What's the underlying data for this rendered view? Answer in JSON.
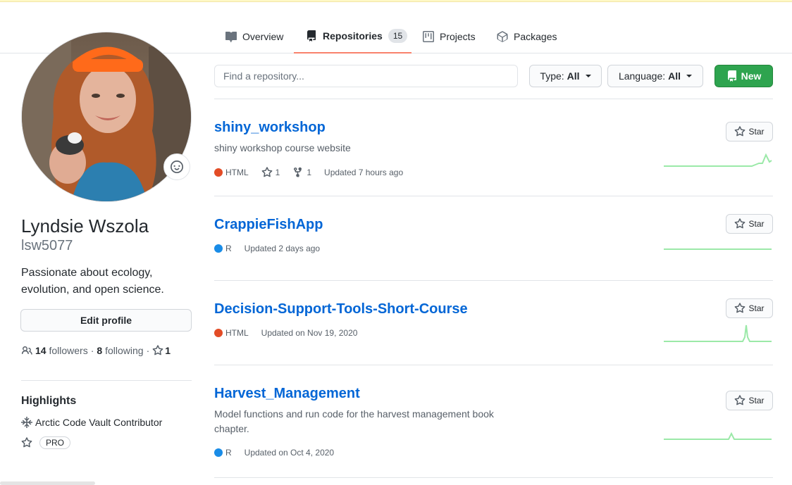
{
  "tabs": [
    {
      "label": "Overview",
      "icon": "book-icon"
    },
    {
      "label": "Repositories",
      "icon": "repo-icon",
      "count": "15"
    },
    {
      "label": "Projects",
      "icon": "project-icon"
    },
    {
      "label": "Packages",
      "icon": "package-icon"
    }
  ],
  "profile": {
    "full_name": "Lyndsie Wszola",
    "username": "lsw5077",
    "bio": "Passionate about ecology, evolution, and open science.",
    "edit_label": "Edit profile",
    "followers_count": "14",
    "followers_label": "followers",
    "following_count": "8",
    "following_label": "following",
    "stars_count": "1",
    "separator": "·"
  },
  "highlights": {
    "title": "Highlights",
    "items": [
      {
        "label": "Arctic Code Vault Contributor",
        "icon": "snowflake-icon"
      },
      {
        "label": "PRO",
        "icon": "star-icon"
      }
    ]
  },
  "filters": {
    "search_placeholder": "Find a repository...",
    "type_label": "Type:",
    "type_value": "All",
    "language_label": "Language:",
    "language_value": "All",
    "new_label": "New"
  },
  "colors": {
    "html": "#e34c26",
    "r": "#198ce7",
    "accent_tab": "#f9826c",
    "link": "#0366d6",
    "new_green": "#2ea44f",
    "spark": "#9be9a8"
  },
  "repos": [
    {
      "name": "shiny_workshop",
      "description": "shiny workshop course website",
      "language": "HTML",
      "stars": "1",
      "forks": "1",
      "updated": "Updated 7 hours ago",
      "star_label": "Star"
    },
    {
      "name": "CrappieFishApp",
      "description": "",
      "language": "R",
      "updated": "Updated 2 days ago",
      "star_label": "Star"
    },
    {
      "name": "Decision-Support-Tools-Short-Course",
      "description": "",
      "language": "HTML",
      "updated": "Updated on Nov 19, 2020",
      "star_label": "Star"
    },
    {
      "name": "Harvest_Management",
      "description": "Model functions and run code for the harvest management book chapter.",
      "language": "R",
      "updated": "Updated on Oct 4, 2020",
      "star_label": "Star"
    }
  ]
}
